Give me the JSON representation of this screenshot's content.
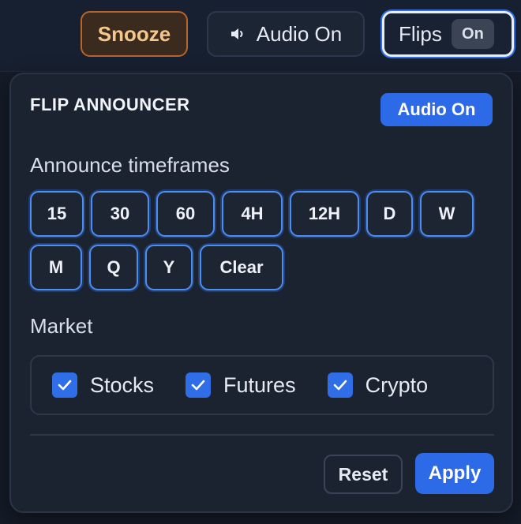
{
  "topbar": {
    "snooze_label": "Snooze",
    "audio_label": "Audio On",
    "flips_label": "Flips",
    "flips_state": "On"
  },
  "panel": {
    "title": "FLIP ANNOUNCER",
    "audio_toggle": "Audio On",
    "timeframes_label": "Announce timeframes",
    "timeframes": [
      "15",
      "30",
      "60",
      "4H",
      "12H",
      "D",
      "W",
      "M",
      "Q",
      "Y",
      "Clear"
    ],
    "market_label": "Market",
    "markets": [
      {
        "label": "Stocks",
        "checked": true
      },
      {
        "label": "Futures",
        "checked": true
      },
      {
        "label": "Crypto",
        "checked": true
      }
    ],
    "reset_label": "Reset",
    "apply_label": "Apply"
  },
  "colors": {
    "accent": "#2d6ae8",
    "snooze_border": "#b8642a",
    "snooze_text": "#f4c88a",
    "panel_bg": "#1b2230"
  },
  "icons": {
    "audio": "speaker-icon",
    "checkbox": "checkmark-icon"
  }
}
